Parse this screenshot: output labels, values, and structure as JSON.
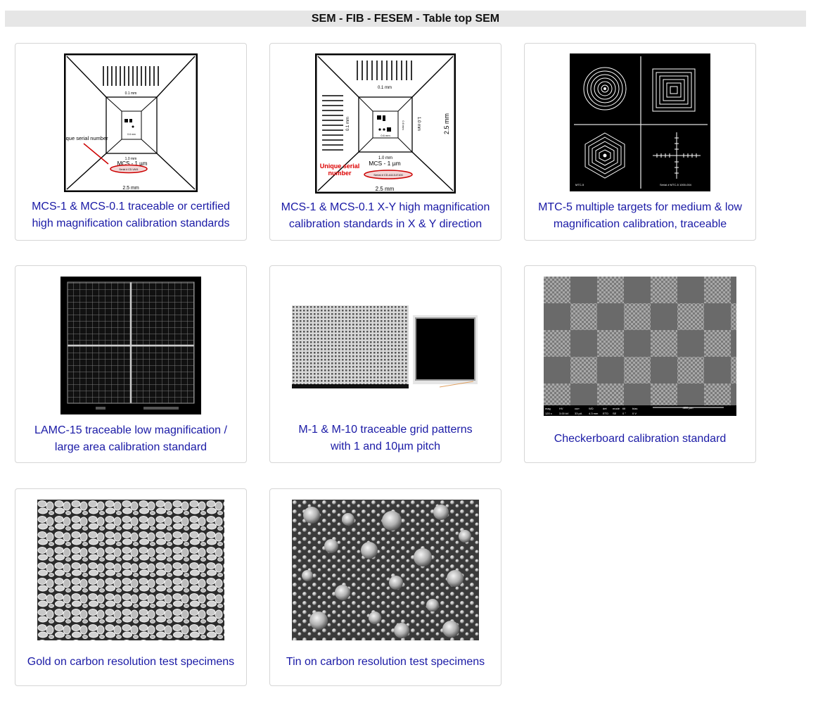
{
  "header": {
    "title": "SEM - FIB - FESEM - Table top SEM"
  },
  "products": [
    {
      "caption_line1": "MCS-1 & MCS-0.1 traceable or certified",
      "caption_line2": "high magnification calibration standards",
      "image": {
        "scale_top": "0.1 mm",
        "scale_inner": "0.6 mm",
        "scale_mid": "1.0 mm",
        "scale_bottom": "2.5 mm",
        "label": "MCS - 1 µm",
        "serial_note": "Unique serial number",
        "serial_plate": "Serial # CD-VA01"
      }
    },
    {
      "caption_line1": "MCS-1 & MCS-0.1 X-Y high magnification",
      "caption_line2": "calibration standards in X & Y direction",
      "image": {
        "scale_top": "0.1 mm",
        "scale_left": "0.1 mm",
        "scale_inner": "0.6 mm",
        "scale_inner_v": "0.6 mm",
        "scale_mid": "1.0 mm",
        "scale_mid_v": "1.0 mm",
        "scale_right": "2.5 mm",
        "scale_bottom": "2.5 mm",
        "label": "MCS - 1 µm",
        "serial_note_1": "Unique serial",
        "serial_note_2": "number",
        "serial_plate": "Serial # CD-A113-E100"
      }
    },
    {
      "caption_line1": "MTC-5 multiple targets for medium & low",
      "caption_line2": "magnification calibration, traceable",
      "image": {
        "corner_left": "MTC-5",
        "corner_right": "Serial # MTC-5 1000-004"
      }
    },
    {
      "caption_line1": "LAMC-15 traceable low magnification /",
      "caption_line2": "large area calibration standard"
    },
    {
      "caption_line1": "M-1 & M-10 traceable grid patterns",
      "caption_line2": "with 1 and 10µm pitch"
    },
    {
      "caption_line1": "Checkerboard calibration standard",
      "caption_line2": "",
      "image": {
        "databar": [
          "mag",
          "HV",
          "curr",
          "WD",
          "det",
          "mode",
          "tilt",
          "bias"
        ],
        "databar_values": [
          "120 x",
          "3.00 kV",
          "33 pA",
          "4.3 mm",
          "ETD",
          "SE",
          "0 °",
          "0 V"
        ],
        "scale_label": "400 µm"
      }
    },
    {
      "caption_line1": "Gold on carbon resolution test specimens",
      "caption_line2": ""
    },
    {
      "caption_line1": "Tin on carbon resolution test specimens",
      "caption_line2": ""
    }
  ]
}
